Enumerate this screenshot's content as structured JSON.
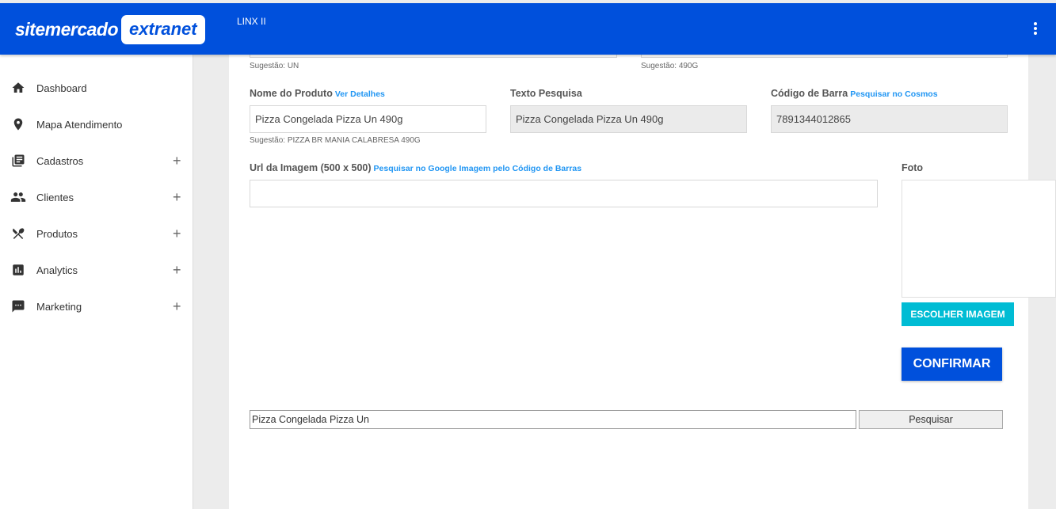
{
  "header": {
    "logo_text": "sitemercado",
    "logo_badge": "extranet",
    "store_name": "LINX II",
    "menu_icon": "more-vert-icon"
  },
  "sidebar": {
    "items": [
      {
        "label": "Dashboard",
        "icon": "home-icon",
        "expandable": false
      },
      {
        "label": "Mapa Atendimento",
        "icon": "location-pin-icon",
        "expandable": false
      },
      {
        "label": "Cadastros",
        "icon": "library-books-icon",
        "expandable": true
      },
      {
        "label": "Clientes",
        "icon": "people-icon",
        "expandable": true
      },
      {
        "label": "Produtos",
        "icon": "utensils-icon",
        "expandable": true
      },
      {
        "label": "Analytics",
        "icon": "bar-chart-icon",
        "expandable": true
      },
      {
        "label": "Marketing",
        "icon": "chat-icon",
        "expandable": true
      }
    ],
    "expand_symbol": "+"
  },
  "form": {
    "top_hints": {
      "left": "Sugestão: UN",
      "right": "Sugestão: 490G"
    },
    "product_name": {
      "label": "Nome do Produto",
      "link": "Ver Detalhes",
      "value": "Pizza Congelada Pizza Un 490g",
      "hint": "Sugestão: PIZZA BR MANIA CALABRESA 490G"
    },
    "search_text": {
      "label": "Texto Pesquisa",
      "value": "Pizza Congelada Pizza Un 490g"
    },
    "barcode": {
      "label": "Código de Barra",
      "link": "Pesquisar no Cosmos",
      "value": "7891344012865"
    },
    "image_url": {
      "label": "Url da Imagem (500 x 500)",
      "link": "Pesquisar no Google Imagem pelo Código de Barras",
      "value": ""
    },
    "photo": {
      "label": "Foto",
      "choose_button": "ESCOLHER IMAGEM"
    },
    "confirm_button": "CONFIRMAR",
    "search_bar": {
      "value": "Pizza Congelada Pizza Un",
      "button": "Pesquisar"
    }
  }
}
